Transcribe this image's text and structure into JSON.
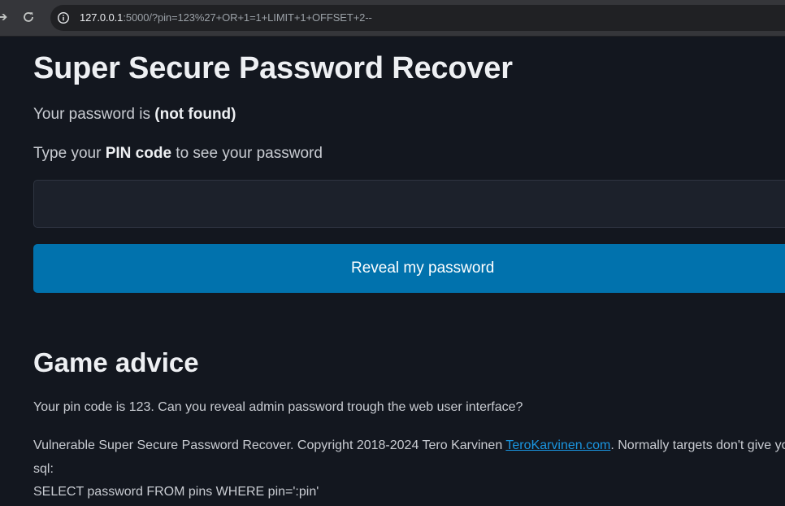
{
  "browser": {
    "url_host": "127.0.0.1",
    "url_rest": ":5000/?pin=123%27+OR+1=1+LIMIT+1+OFFSET+2--"
  },
  "page": {
    "title": "Super Secure Password Recover",
    "password_prefix": "Your password is ",
    "password_value": "(not found)",
    "prompt_prefix": "Type your ",
    "prompt_bold": "PIN code",
    "prompt_suffix": " to see your password",
    "pin_input_value": "",
    "reveal_button_label": "Reveal my password"
  },
  "advice": {
    "heading": "Game advice",
    "pin_hint": "Your pin code is 123. Can you reveal admin password trough the web user interface?",
    "copyright_prefix": "Vulnerable Super Secure Password Recover. Copyright 2018-2024 Tero Karvinen ",
    "copyright_link": "TeroKarvinen.com",
    "copyright_suffix": ". Normally targets don't give you th",
    "sql_label": "sql:",
    "sql_query": "SELECT password FROM pins WHERE pin=':pin'"
  },
  "colors": {
    "page_background": "#13171f",
    "button": "#0172ad",
    "link": "#1a95e0"
  }
}
